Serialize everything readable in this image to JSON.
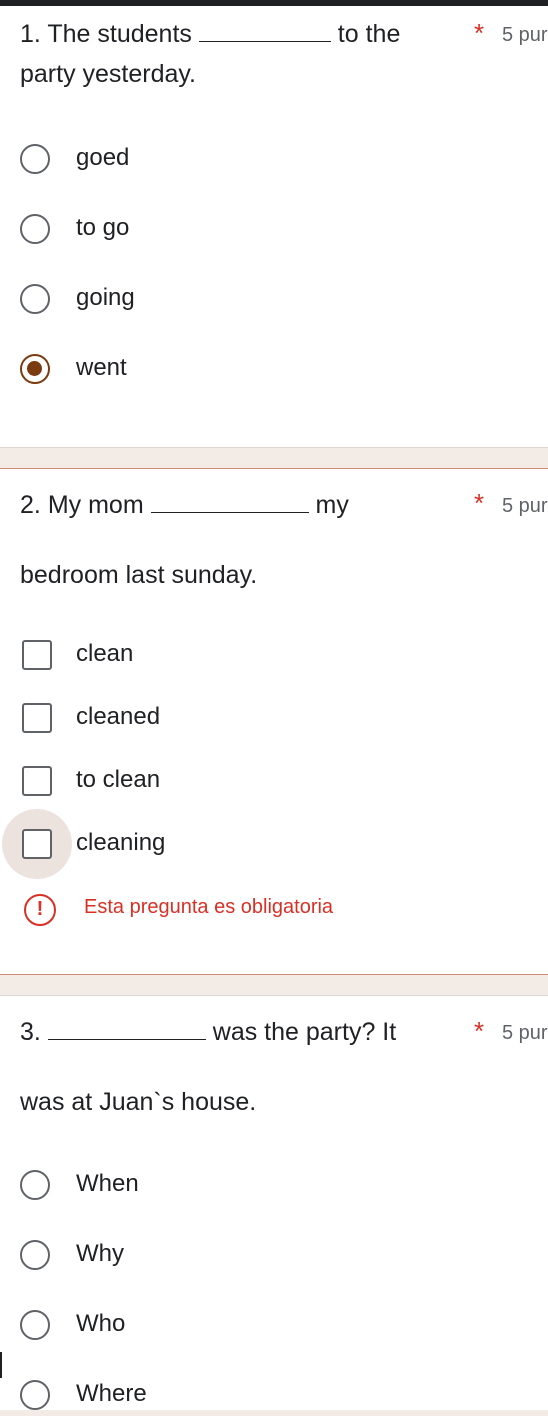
{
  "questions": [
    {
      "number": "1.",
      "line1_before": "The students",
      "line1_after": "to the",
      "line2": "party yesterday.",
      "required_mark": "*",
      "points": "5 pur",
      "type": "radio",
      "options": [
        {
          "label": "goed",
          "selected": false
        },
        {
          "label": "to go",
          "selected": false
        },
        {
          "label": "going",
          "selected": false
        },
        {
          "label": "went",
          "selected": true
        }
      ]
    },
    {
      "number": "2.",
      "line1_before": "My mom",
      "line1_after": "my",
      "line2": "bedroom last sunday.",
      "required_mark": "*",
      "points": "5 pur",
      "type": "checkbox",
      "options": [
        {
          "label": "clean",
          "selected": false
        },
        {
          "label": "cleaned",
          "selected": false
        },
        {
          "label": "to clean",
          "selected": false
        },
        {
          "label": "cleaning",
          "selected": false
        }
      ],
      "error_icon": "!",
      "error": "Esta pregunta es obligatoria"
    },
    {
      "number": "3.",
      "line1_before": "",
      "line1_after": "was the party? It",
      "line2": "was at Juan`s house.",
      "required_mark": "*",
      "points": "5 pur",
      "type": "radio",
      "options": [
        {
          "label": "When",
          "selected": false
        },
        {
          "label": "Why",
          "selected": false
        },
        {
          "label": "Who",
          "selected": false
        },
        {
          "label": "Where",
          "selected": false
        }
      ]
    }
  ],
  "colors": {
    "accent": "#7a3b10",
    "required": "#d93025",
    "section_gap": "#f3ebe6",
    "text": "#202124"
  }
}
